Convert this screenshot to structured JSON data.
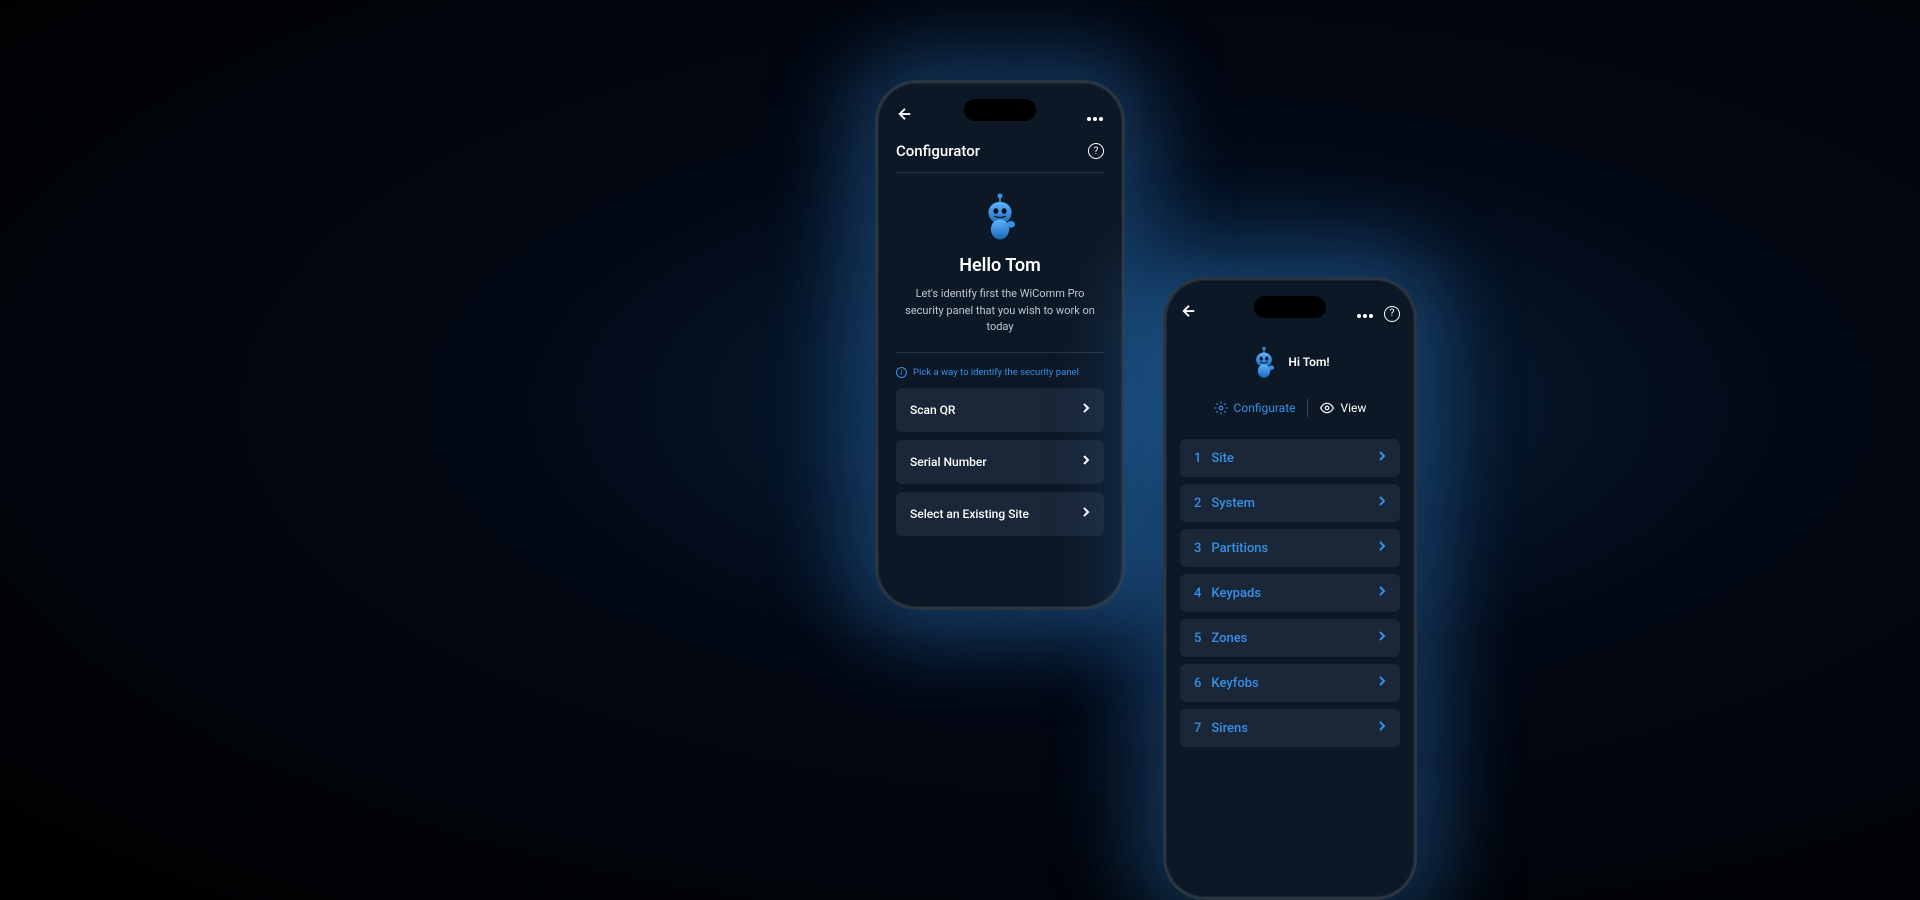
{
  "phone1": {
    "header_title": "Configurator",
    "hello_title": "Hello Tom",
    "hello_subtitle": "Let's identify first the WiComm Pro security panel that you wish to work on today",
    "hint_text": "Pick a way to identify the security panel",
    "options": [
      {
        "label": "Scan QR"
      },
      {
        "label": "Serial Number"
      },
      {
        "label": "Select an Existing Site"
      }
    ]
  },
  "phone2": {
    "greeting": "Hi Tom!",
    "mode_configurate": "Configurate",
    "mode_view": "View",
    "menu": [
      {
        "num": "1",
        "label": "Site"
      },
      {
        "num": "2",
        "label": "System"
      },
      {
        "num": "3",
        "label": "Partitions"
      },
      {
        "num": "4",
        "label": "Keypads"
      },
      {
        "num": "5",
        "label": "Zones"
      },
      {
        "num": "6",
        "label": "Keyfobs"
      },
      {
        "num": "7",
        "label": "Sirens"
      }
    ]
  }
}
